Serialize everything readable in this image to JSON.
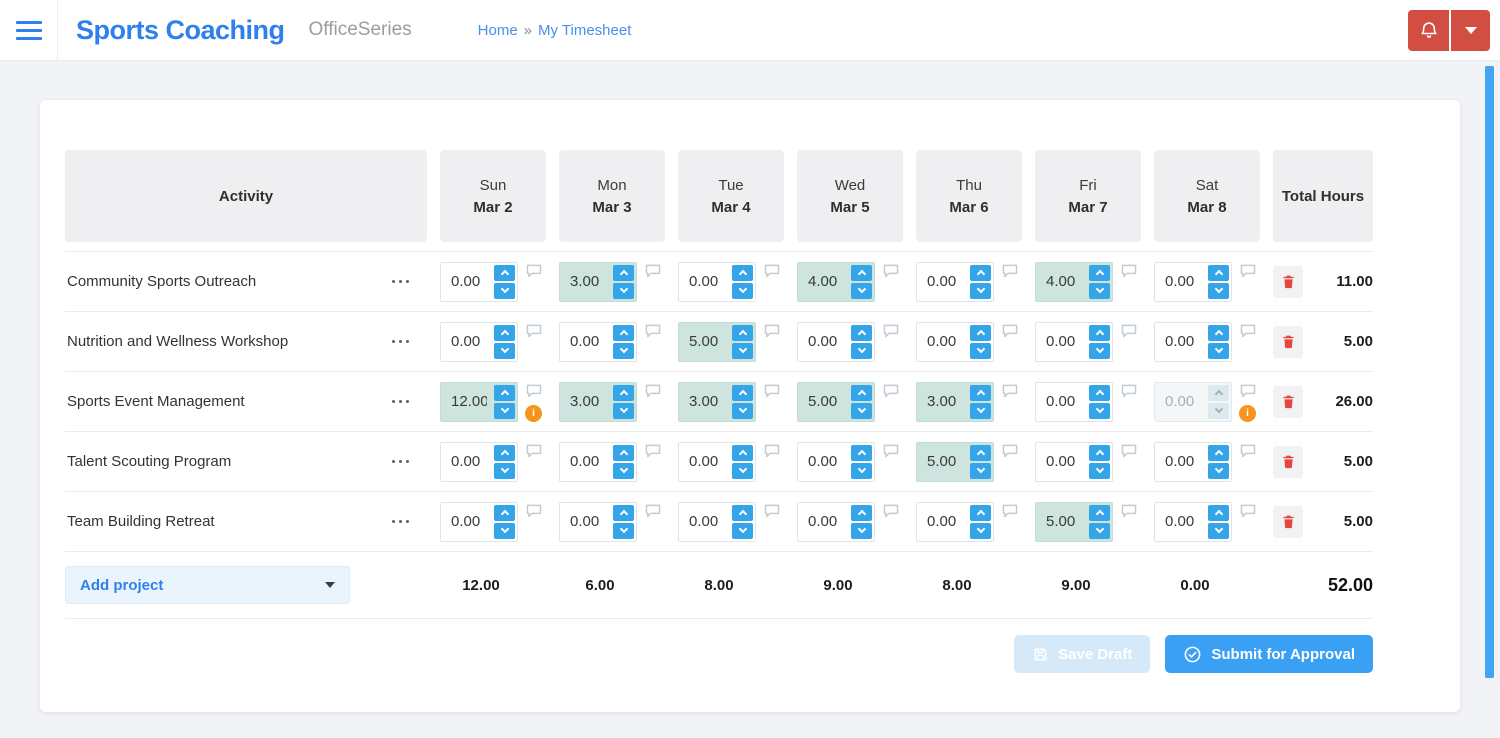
{
  "header": {
    "app_title": "Sports Coaching",
    "suite_name": "OfficeSeries",
    "breadcrumb": {
      "home": "Home",
      "separator": "»",
      "current": "My Timesheet"
    }
  },
  "icons": {
    "menu": "hamburger-icon",
    "notifications": "bell-icon",
    "account_dropdown": "caret-down-icon",
    "row_menu": "ellipsis-icon",
    "comment": "speech-bubble-icon",
    "warning": "info-circle-icon",
    "delete": "trash-icon",
    "save": "floppy-disk-icon",
    "submit": "check-circle-icon"
  },
  "timesheet": {
    "activity_header": "Activity",
    "total_header": "Total Hours",
    "columns": [
      {
        "day": "Sun",
        "date": "Mar 2"
      },
      {
        "day": "Mon",
        "date": "Mar 3"
      },
      {
        "day": "Tue",
        "date": "Mar 4"
      },
      {
        "day": "Wed",
        "date": "Mar 5"
      },
      {
        "day": "Thu",
        "date": "Mar 6"
      },
      {
        "day": "Fri",
        "date": "Mar 7"
      },
      {
        "day": "Sat",
        "date": "Mar 8"
      }
    ],
    "rows": [
      {
        "activity": "Community Sports Outreach",
        "cells": [
          {
            "value": "0.00",
            "filled": false,
            "disabled": false,
            "warning": false
          },
          {
            "value": "3.00",
            "filled": true,
            "disabled": false,
            "warning": false
          },
          {
            "value": "0.00",
            "filled": false,
            "disabled": false,
            "warning": false
          },
          {
            "value": "4.00",
            "filled": true,
            "disabled": false,
            "warning": false
          },
          {
            "value": "0.00",
            "filled": false,
            "disabled": false,
            "warning": false
          },
          {
            "value": "4.00",
            "filled": true,
            "disabled": false,
            "warning": false
          },
          {
            "value": "0.00",
            "filled": false,
            "disabled": false,
            "warning": false
          }
        ],
        "total": "11.00"
      },
      {
        "activity": "Nutrition and Wellness Workshop",
        "cells": [
          {
            "value": "0.00",
            "filled": false,
            "disabled": false,
            "warning": false
          },
          {
            "value": "0.00",
            "filled": false,
            "disabled": false,
            "warning": false
          },
          {
            "value": "5.00",
            "filled": true,
            "disabled": false,
            "warning": false
          },
          {
            "value": "0.00",
            "filled": false,
            "disabled": false,
            "warning": false
          },
          {
            "value": "0.00",
            "filled": false,
            "disabled": false,
            "warning": false
          },
          {
            "value": "0.00",
            "filled": false,
            "disabled": false,
            "warning": false
          },
          {
            "value": "0.00",
            "filled": false,
            "disabled": false,
            "warning": false
          }
        ],
        "total": "5.00"
      },
      {
        "activity": "Sports Event Management",
        "cells": [
          {
            "value": "12.00",
            "filled": true,
            "disabled": false,
            "warning": true
          },
          {
            "value": "3.00",
            "filled": true,
            "disabled": false,
            "warning": false
          },
          {
            "value": "3.00",
            "filled": true,
            "disabled": false,
            "warning": false
          },
          {
            "value": "5.00",
            "filled": true,
            "disabled": false,
            "warning": false
          },
          {
            "value": "3.00",
            "filled": true,
            "disabled": false,
            "warning": false
          },
          {
            "value": "0.00",
            "filled": false,
            "disabled": false,
            "warning": false
          },
          {
            "value": "0.00",
            "filled": false,
            "disabled": true,
            "warning": true
          }
        ],
        "total": "26.00"
      },
      {
        "activity": "Talent Scouting Program",
        "cells": [
          {
            "value": "0.00",
            "filled": false,
            "disabled": false,
            "warning": false
          },
          {
            "value": "0.00",
            "filled": false,
            "disabled": false,
            "warning": false
          },
          {
            "value": "0.00",
            "filled": false,
            "disabled": false,
            "warning": false
          },
          {
            "value": "0.00",
            "filled": false,
            "disabled": false,
            "warning": false
          },
          {
            "value": "5.00",
            "filled": true,
            "disabled": false,
            "warning": false
          },
          {
            "value": "0.00",
            "filled": false,
            "disabled": false,
            "warning": false
          },
          {
            "value": "0.00",
            "filled": false,
            "disabled": false,
            "warning": false
          }
        ],
        "total": "5.00"
      },
      {
        "activity": "Team Building Retreat",
        "cells": [
          {
            "value": "0.00",
            "filled": false,
            "disabled": false,
            "warning": false
          },
          {
            "value": "0.00",
            "filled": false,
            "disabled": false,
            "warning": false
          },
          {
            "value": "0.00",
            "filled": false,
            "disabled": false,
            "warning": false
          },
          {
            "value": "0.00",
            "filled": false,
            "disabled": false,
            "warning": false
          },
          {
            "value": "0.00",
            "filled": false,
            "disabled": false,
            "warning": false
          },
          {
            "value": "5.00",
            "filled": true,
            "disabled": false,
            "warning": false
          },
          {
            "value": "0.00",
            "filled": false,
            "disabled": false,
            "warning": false
          }
        ],
        "total": "5.00"
      }
    ],
    "footer": {
      "add_project_label": "Add project",
      "column_totals": [
        "12.00",
        "6.00",
        "8.00",
        "9.00",
        "8.00",
        "9.00",
        "0.00"
      ],
      "grand_total": "52.00"
    },
    "actions": {
      "save_draft_label": "Save Draft",
      "submit_label": "Submit for Approval"
    }
  },
  "colors": {
    "brand_blue": "#2f80ed",
    "breadcrumb_blue": "#4a8fe8",
    "header_button_red": "#d24d42",
    "spinner_arrow_blue": "#35a5ea",
    "filled_cell_teal": "#cde4df",
    "warning_orange": "#f7941d",
    "delete_red": "#e8453c",
    "submit_blue": "#3aa0f3",
    "save_draft_disabled": "#d6e9f8",
    "scrollbar_blue": "#41a4f4",
    "page_bg": "#f1f3f6"
  }
}
